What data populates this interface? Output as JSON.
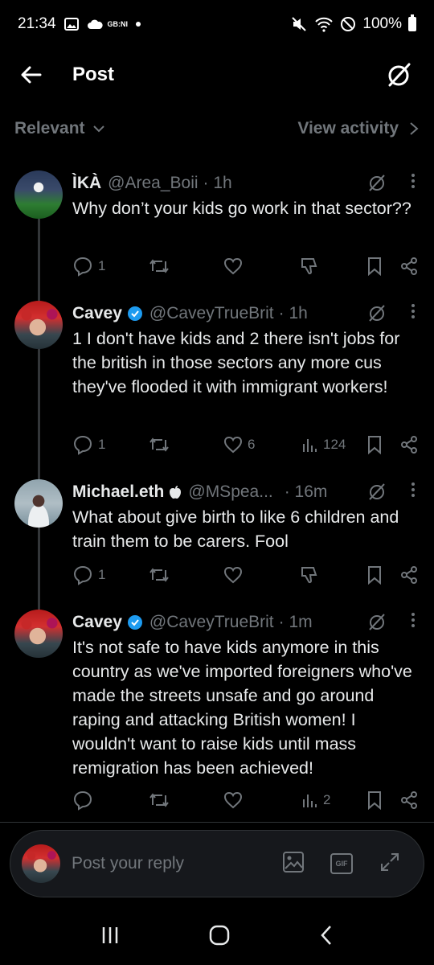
{
  "status_bar": {
    "time": "21:34",
    "network_label": "GB:NI",
    "battery": "100%"
  },
  "header": {
    "title": "Post"
  },
  "sort": {
    "label": "Relevant",
    "activity": "View activity"
  },
  "posts": [
    {
      "name": "ÌKÀ",
      "handle": "@Area_Boii",
      "time": "· 1h",
      "verified": false,
      "text": "Why don’t your kids go work in that sector??",
      "replies": "1",
      "reposts": "",
      "likes": "",
      "views": ""
    },
    {
      "name": "Cavey",
      "handle": "@CaveyTrueBrit",
      "time": "· 1h",
      "verified": true,
      "text": "1 I don't have kids and 2 there isn't jobs for the british in those sectors any more cus they've flooded it with immigrant workers!",
      "replies": "1",
      "reposts": "",
      "likes": "6",
      "views": "124"
    },
    {
      "name": "Michael.eth",
      "handle": "@MSpea...",
      "time": "· 16m",
      "verified": false,
      "text": "What about give birth to like 6 children and train them to be carers. Fool",
      "replies": "1",
      "reposts": "",
      "likes": "",
      "views": ""
    },
    {
      "name": "Cavey",
      "handle": "@CaveyTrueBrit",
      "time": "· 1m",
      "verified": true,
      "text": "It's not safe to have kids anymore in this country as we've imported foreigners who've made the streets unsafe and go around raping and attacking British women! I wouldn't want to raise kids until mass remigration has been achieved!",
      "replies": "",
      "reposts": "",
      "likes": "",
      "views": "2"
    }
  ],
  "reply": {
    "placeholder": "Post your reply",
    "gif_label": "GIF"
  },
  "colors": {
    "background": "#000000",
    "text": "#e7e9ea",
    "muted": "#71767b",
    "verified": "#1d9bf0"
  }
}
